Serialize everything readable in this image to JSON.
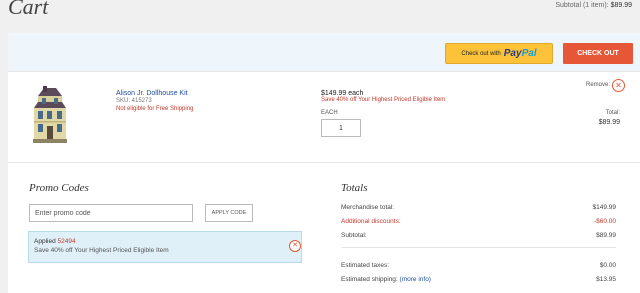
{
  "page": {
    "title": "Cart",
    "subtotal_label": "Subtotal (1 item):",
    "subtotal_amount": "$89.99"
  },
  "checkout": {
    "paypal_prefix": "Check out with",
    "paypal_brand_pay": "Pay",
    "paypal_brand_pal": "Pal",
    "checkout_label": "CHECK OUT"
  },
  "item": {
    "name": "Alison Jr. Dollhouse Kit",
    "sku": "SKU: 415273",
    "shipping_note": "Not eligible for Free Shipping",
    "price": "$149.99 each",
    "promo_note": "Save 40% off Your Highest Priced Eligible Item",
    "qty_label": "EACH",
    "qty_value": "1",
    "remove_label": "Remove:",
    "total_label": "Total:",
    "total_amount": "$89.99"
  },
  "promo": {
    "title": "Promo Codes",
    "input_placeholder": "Enter promo code",
    "apply_label": "APPLY CODE",
    "applied_prefix": "Applied",
    "applied_code": "52494",
    "applied_desc": "Save 40% off Your Highest Priced Eligible Item"
  },
  "totals": {
    "title": "Totals",
    "rows": [
      {
        "label": "Merchandise total:",
        "value": "$149.99"
      },
      {
        "label": "Additional discounts:",
        "value": "-$60.00"
      },
      {
        "label": "Subtotal:",
        "value": "$89.99"
      },
      {
        "label": "Estimated taxes:",
        "value": "$0.00"
      },
      {
        "label": "Estimated shipping:",
        "more": "(more info)",
        "value": "$13.95"
      }
    ]
  },
  "colors": {
    "accent": "#e55736",
    "paypal_yellow": "#fcc33a",
    "link_blue": "#1e4e9c",
    "promo_red": "#c0392b",
    "applied_bg": "#dff0f8"
  }
}
